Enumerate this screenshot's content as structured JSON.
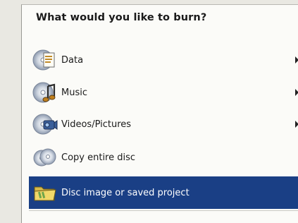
{
  "heading": "What would you like to burn?",
  "menu": {
    "items": [
      {
        "label": "Data",
        "icon": "data-disc-icon",
        "has_submenu": true,
        "selected": false
      },
      {
        "label": "Music",
        "icon": "music-disc-icon",
        "has_submenu": true,
        "selected": false
      },
      {
        "label": "Videos/Pictures",
        "icon": "video-disc-icon",
        "has_submenu": true,
        "selected": false
      },
      {
        "label": "Copy entire disc",
        "icon": "copy-disc-icon",
        "has_submenu": false,
        "selected": false
      },
      {
        "label": "Disc image or saved project",
        "icon": "folder-icon",
        "has_submenu": false,
        "selected": true
      }
    ]
  },
  "colors": {
    "selection": "#1a3f85",
    "panel_background": "#fbfbf8",
    "outer_background": "#e9e8e2"
  }
}
